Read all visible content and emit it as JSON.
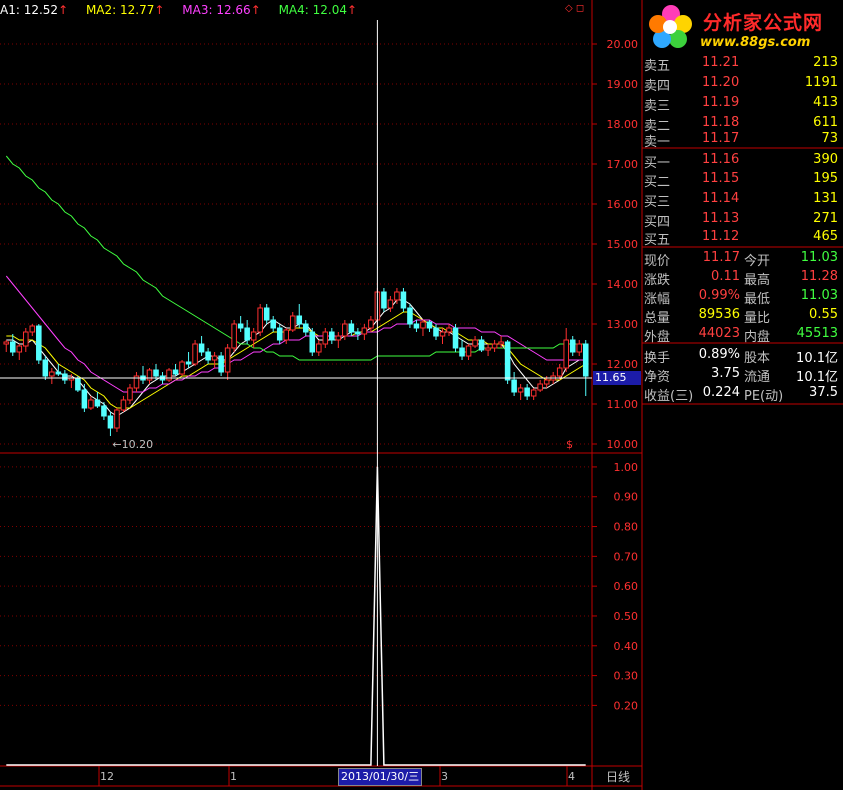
{
  "ma_bar": [
    {
      "label": "A1: 12.52",
      "color": "#ffffff",
      "arrow": "↑"
    },
    {
      "label": "MA2: 12.77",
      "color": "#ffff00",
      "arrow": "↑"
    },
    {
      "label": "MA3: 12.66",
      "color": "#ff40ff",
      "arrow": "↑"
    },
    {
      "label": "MA4: 12.04",
      "color": "#40ff40",
      "arrow": "↑"
    }
  ],
  "arrow_color": "#ff3030",
  "corner_icons": "◇ ◻",
  "logo": {
    "title": "分析家公式网",
    "url": "www.88gs.com"
  },
  "chart_data": [
    {
      "type": "candlestick",
      "y_ticks": [
        "20.00",
        "19.00",
        "18.00",
        "17.00",
        "16.00",
        "15.00",
        "14.00",
        "13.00",
        "12.00",
        "11.00",
        "10.00"
      ],
      "ylim": [
        9.8,
        20.6
      ],
      "low_marker": "10.20",
      "current_price_tag": "11.65",
      "x_labels": [
        "12",
        "1",
        "3",
        "4"
      ],
      "crosshair_date": "2013/01/30/三",
      "corner_mark": "$",
      "candles": [
        [
          12.5,
          12.6,
          12.3,
          12.55
        ],
        [
          12.55,
          12.75,
          12.2,
          12.3
        ],
        [
          12.3,
          12.5,
          12.1,
          12.45
        ],
        [
          12.45,
          12.9,
          12.3,
          12.8
        ],
        [
          12.8,
          13.0,
          12.7,
          12.95
        ],
        [
          12.95,
          13.0,
          12.0,
          12.1
        ],
        [
          12.1,
          12.2,
          11.6,
          11.7
        ],
        [
          11.7,
          11.9,
          11.5,
          11.8
        ],
        [
          11.8,
          12.0,
          11.7,
          11.75
        ],
        [
          11.75,
          11.85,
          11.5,
          11.6
        ],
        [
          11.6,
          11.75,
          11.4,
          11.65
        ],
        [
          11.65,
          11.7,
          11.3,
          11.35
        ],
        [
          11.35,
          11.5,
          10.8,
          10.9
        ],
        [
          10.9,
          11.2,
          10.85,
          11.1
        ],
        [
          11.1,
          11.3,
          10.9,
          10.95
        ],
        [
          10.95,
          11.05,
          10.6,
          10.7
        ],
        [
          10.7,
          10.8,
          10.2,
          10.4
        ],
        [
          10.4,
          10.9,
          10.3,
          10.85
        ],
        [
          10.85,
          11.2,
          10.8,
          11.1
        ],
        [
          11.1,
          11.5,
          11.0,
          11.4
        ],
        [
          11.4,
          11.8,
          11.3,
          11.7
        ],
        [
          11.7,
          11.95,
          11.5,
          11.6
        ],
        [
          11.6,
          11.9,
          11.5,
          11.85
        ],
        [
          11.85,
          12.0,
          11.6,
          11.7
        ],
        [
          11.7,
          11.8,
          11.5,
          11.6
        ],
        [
          11.6,
          11.9,
          11.55,
          11.85
        ],
        [
          11.85,
          12.0,
          11.7,
          11.75
        ],
        [
          11.75,
          12.1,
          11.7,
          12.05
        ],
        [
          12.05,
          12.3,
          11.9,
          12.0
        ],
        [
          12.0,
          12.6,
          11.95,
          12.5
        ],
        [
          12.5,
          12.7,
          12.2,
          12.3
        ],
        [
          12.3,
          12.4,
          12.0,
          12.1
        ],
        [
          12.1,
          12.3,
          11.9,
          12.2
        ],
        [
          12.2,
          12.3,
          11.7,
          11.8
        ],
        [
          11.8,
          12.5,
          11.6,
          12.4
        ],
        [
          12.4,
          13.1,
          12.3,
          13.0
        ],
        [
          13.0,
          13.2,
          12.8,
          12.9
        ],
        [
          12.9,
          13.1,
          12.5,
          12.6
        ],
        [
          12.6,
          12.9,
          12.4,
          12.8
        ],
        [
          12.8,
          13.5,
          12.7,
          13.4
        ],
        [
          13.4,
          13.5,
          13.0,
          13.1
        ],
        [
          13.1,
          13.2,
          12.8,
          12.9
        ],
        [
          12.9,
          13.0,
          12.5,
          12.6
        ],
        [
          12.6,
          12.9,
          12.5,
          12.85
        ],
        [
          12.85,
          13.3,
          12.8,
          13.2
        ],
        [
          13.2,
          13.5,
          12.9,
          13.0
        ],
        [
          13.0,
          13.1,
          12.7,
          12.8
        ],
        [
          12.8,
          12.9,
          12.2,
          12.3
        ],
        [
          12.3,
          12.6,
          12.2,
          12.5
        ],
        [
          12.5,
          12.9,
          12.4,
          12.8
        ],
        [
          12.8,
          12.9,
          12.5,
          12.6
        ],
        [
          12.6,
          12.8,
          12.4,
          12.7
        ],
        [
          12.7,
          13.1,
          12.6,
          13.0
        ],
        [
          13.0,
          13.1,
          12.7,
          12.8
        ],
        [
          12.8,
          12.9,
          12.6,
          12.75
        ],
        [
          12.75,
          13.0,
          12.6,
          12.9
        ],
        [
          12.9,
          13.2,
          12.8,
          13.1
        ],
        [
          13.1,
          13.9,
          13.0,
          13.8
        ],
        [
          13.8,
          13.9,
          13.3,
          13.4
        ],
        [
          13.4,
          13.7,
          13.3,
          13.6
        ],
        [
          13.6,
          13.9,
          13.5,
          13.8
        ],
        [
          13.8,
          13.9,
          13.3,
          13.4
        ],
        [
          13.4,
          13.5,
          12.9,
          13.0
        ],
        [
          13.0,
          13.1,
          12.8,
          12.9
        ],
        [
          12.9,
          13.1,
          12.7,
          13.05
        ],
        [
          13.05,
          13.1,
          12.8,
          12.9
        ],
        [
          12.9,
          13.0,
          12.6,
          12.7
        ],
        [
          12.7,
          12.9,
          12.5,
          12.8
        ],
        [
          12.8,
          13.0,
          12.7,
          12.9
        ],
        [
          12.9,
          13.0,
          12.3,
          12.4
        ],
        [
          12.4,
          12.6,
          12.1,
          12.2
        ],
        [
          12.2,
          12.5,
          12.1,
          12.45
        ],
        [
          12.45,
          12.7,
          12.4,
          12.6
        ],
        [
          12.6,
          12.7,
          12.3,
          12.35
        ],
        [
          12.35,
          12.5,
          12.2,
          12.4
        ],
        [
          12.4,
          12.6,
          12.3,
          12.5
        ],
        [
          12.5,
          12.7,
          12.4,
          12.55
        ],
        [
          12.55,
          12.6,
          11.5,
          11.6
        ],
        [
          11.6,
          11.8,
          11.2,
          11.3
        ],
        [
          11.3,
          11.5,
          11.1,
          11.4
        ],
        [
          11.4,
          11.5,
          11.1,
          11.2
        ],
        [
          11.2,
          11.4,
          11.1,
          11.35
        ],
        [
          11.35,
          11.6,
          11.3,
          11.5
        ],
        [
          11.5,
          11.7,
          11.4,
          11.6
        ],
        [
          11.6,
          11.8,
          11.5,
          11.7
        ],
        [
          11.7,
          12.0,
          11.6,
          11.9
        ],
        [
          11.9,
          12.9,
          11.8,
          12.6
        ],
        [
          12.6,
          12.7,
          12.2,
          12.3
        ],
        [
          12.3,
          12.6,
          12.2,
          12.5
        ],
        [
          12.5,
          12.6,
          11.2,
          11.7
        ]
      ],
      "ma_series": [
        {
          "color": "#ffffff",
          "values": [
            12.6,
            12.6,
            12.5,
            12.5,
            12.6,
            12.4,
            12.2,
            12.0,
            11.8,
            11.7,
            11.7,
            11.6,
            11.4,
            11.2,
            11.1,
            11.0,
            10.8,
            10.7,
            10.8,
            10.9,
            11.1,
            11.3,
            11.5,
            11.6,
            11.7,
            11.7,
            11.7,
            11.8,
            11.9,
            12.0,
            12.1,
            12.2,
            12.2,
            12.1,
            12.1,
            12.3,
            12.5,
            12.6,
            12.7,
            12.8,
            13.0,
            13.1,
            13.0,
            12.9,
            12.9,
            13.0,
            13.0,
            12.8,
            12.6,
            12.6,
            12.6,
            12.6,
            12.7,
            12.8,
            12.8,
            12.8,
            12.9,
            13.1,
            13.3,
            13.4,
            13.6,
            13.6,
            13.5,
            13.3,
            13.1,
            13.0,
            12.9,
            12.8,
            12.8,
            12.7,
            12.6,
            12.5,
            12.5,
            12.5,
            12.5,
            12.5,
            12.5,
            12.3,
            12.0,
            11.8,
            11.6,
            11.4,
            11.4,
            11.4,
            11.5,
            11.6,
            11.9,
            12.0,
            12.1,
            12.1
          ]
        },
        {
          "color": "#ffff00",
          "values": [
            12.7,
            12.7,
            12.6,
            12.6,
            12.6,
            12.5,
            12.4,
            12.2,
            12.0,
            11.9,
            11.8,
            11.7,
            11.6,
            11.4,
            11.3,
            11.2,
            11.0,
            10.9,
            10.9,
            10.9,
            11.0,
            11.1,
            11.2,
            11.3,
            11.4,
            11.5,
            11.6,
            11.7,
            11.7,
            11.8,
            11.9,
            12.0,
            12.0,
            12.0,
            12.1,
            12.2,
            12.3,
            12.4,
            12.5,
            12.6,
            12.7,
            12.8,
            12.8,
            12.8,
            12.9,
            12.9,
            12.9,
            12.8,
            12.7,
            12.7,
            12.7,
            12.7,
            12.7,
            12.7,
            12.8,
            12.8,
            12.8,
            12.9,
            13.0,
            13.1,
            13.2,
            13.3,
            13.3,
            13.2,
            13.1,
            13.0,
            12.9,
            12.9,
            12.8,
            12.8,
            12.7,
            12.6,
            12.6,
            12.6,
            12.5,
            12.5,
            12.5,
            12.4,
            12.2,
            12.0,
            11.9,
            11.8,
            11.7,
            11.6,
            11.6,
            11.6,
            11.7,
            11.8,
            11.9,
            12.0
          ]
        },
        {
          "color": "#ff40ff",
          "values": [
            14.2,
            14.0,
            13.8,
            13.6,
            13.4,
            13.2,
            13.0,
            12.8,
            12.6,
            12.4,
            12.3,
            12.1,
            12.0,
            11.8,
            11.7,
            11.6,
            11.5,
            11.4,
            11.3,
            11.3,
            11.3,
            11.3,
            11.4,
            11.4,
            11.5,
            11.5,
            11.6,
            11.6,
            11.7,
            11.7,
            11.8,
            11.8,
            11.9,
            11.9,
            12.0,
            12.1,
            12.1,
            12.2,
            12.3,
            12.3,
            12.4,
            12.5,
            12.5,
            12.6,
            12.6,
            12.6,
            12.7,
            12.7,
            12.7,
            12.7,
            12.7,
            12.7,
            12.7,
            12.7,
            12.7,
            12.8,
            12.8,
            12.8,
            12.9,
            12.9,
            13.0,
            13.0,
            13.0,
            13.1,
            13.1,
            13.1,
            13.0,
            13.0,
            13.0,
            12.9,
            12.9,
            12.9,
            12.9,
            12.8,
            12.8,
            12.8,
            12.7,
            12.7,
            12.6,
            12.5,
            12.4,
            12.3,
            12.2,
            12.1,
            12.1,
            12.1,
            12.1,
            12.1,
            12.1,
            12.1
          ]
        },
        {
          "color": "#40ff40",
          "values": [
            17.2,
            17.0,
            16.9,
            16.7,
            16.6,
            16.4,
            16.3,
            16.1,
            16.0,
            15.8,
            15.7,
            15.5,
            15.4,
            15.2,
            15.1,
            14.9,
            14.8,
            14.7,
            14.5,
            14.4,
            14.3,
            14.1,
            14.0,
            13.9,
            13.7,
            13.6,
            13.5,
            13.4,
            13.3,
            13.2,
            13.1,
            13.0,
            12.9,
            12.8,
            12.7,
            12.6,
            12.5,
            12.5,
            12.4,
            12.4,
            12.3,
            12.3,
            12.2,
            12.2,
            12.2,
            12.1,
            12.1,
            12.1,
            12.1,
            12.1,
            12.1,
            12.1,
            12.1,
            12.1,
            12.1,
            12.1,
            12.1,
            12.2,
            12.2,
            12.2,
            12.2,
            12.2,
            12.2,
            12.2,
            12.2,
            12.2,
            12.3,
            12.3,
            12.3,
            12.3,
            12.3,
            12.3,
            12.3,
            12.4,
            12.4,
            12.4,
            12.4,
            12.4,
            12.4,
            12.4,
            12.4,
            12.4,
            12.4,
            12.4,
            12.4,
            12.5,
            12.5,
            12.5,
            12.5,
            12.5
          ]
        }
      ]
    },
    {
      "type": "line",
      "y_ticks": [
        "1.00",
        "0.90",
        "0.80",
        "0.70",
        "0.60",
        "0.50",
        "0.40",
        "0.30",
        "0.20"
      ],
      "ylim": [
        0.0,
        1.04
      ],
      "spike_index": 57,
      "spike_value": 1.0,
      "n": 90
    }
  ],
  "order_book": {
    "asks": [
      {
        "label": "卖五",
        "price": "11.21",
        "vol": "213"
      },
      {
        "label": "卖四",
        "price": "11.20",
        "vol": "1191"
      },
      {
        "label": "卖三",
        "price": "11.19",
        "vol": "413"
      },
      {
        "label": "卖二",
        "price": "11.18",
        "vol": "611"
      },
      {
        "label": "卖一",
        "price": "11.17",
        "vol": "73"
      }
    ],
    "bids": [
      {
        "label": "买一",
        "price": "11.16",
        "vol": "390"
      },
      {
        "label": "买二",
        "price": "11.15",
        "vol": "195"
      },
      {
        "label": "买三",
        "price": "11.14",
        "vol": "131"
      },
      {
        "label": "买四",
        "price": "11.13",
        "vol": "271"
      },
      {
        "label": "买五",
        "price": "11.12",
        "vol": "465"
      }
    ]
  },
  "stats": [
    {
      "l1": "现价",
      "v1": "11.17",
      "c1": "red",
      "l2": "今开",
      "v2": "11.03",
      "c2": "green"
    },
    {
      "l1": "涨跌",
      "v1": "0.11",
      "c1": "red",
      "l2": "最高",
      "v2": "11.28",
      "c2": "red"
    },
    {
      "l1": "涨幅",
      "v1": "0.99%",
      "c1": "red",
      "l2": "最低",
      "v2": "11.03",
      "c2": "green"
    },
    {
      "l1": "总量",
      "v1": "89536",
      "c1": "yellow",
      "l2": "量比",
      "v2": "0.55",
      "c2": "yellow"
    },
    {
      "l1": "外盘",
      "v1": "44023",
      "c1": "red",
      "l2": "内盘",
      "v2": "45513",
      "c2": "green"
    },
    {
      "l1": "换手",
      "v1": "0.89%",
      "c1": "white",
      "l2": "股本",
      "v2": "10.1亿",
      "c2": "white"
    },
    {
      "l1": "净资",
      "v1": "3.75",
      "c1": "white",
      "l2": "流通",
      "v2": "10.1亿",
      "c2": "white"
    },
    {
      "l1": "收益(三)",
      "v1": "0.224",
      "c1": "white",
      "l2": "PE(动)",
      "v2": "37.5",
      "c2": "white"
    }
  ],
  "period_tab": "日线"
}
